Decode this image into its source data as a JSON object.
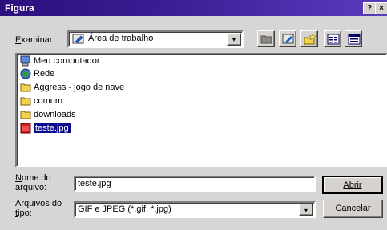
{
  "window": {
    "title": "Figura",
    "help_glyph": "?",
    "close_glyph": "×"
  },
  "lookin": {
    "label": "Examinar:",
    "value": "Área de trabalho",
    "dropdown_glyph": "▾"
  },
  "toolbar": {
    "icons": [
      "up-folder-icon",
      "desktop-icon",
      "new-folder-icon",
      "list-view-icon",
      "details-view-icon"
    ]
  },
  "files": [
    {
      "name": "Meu computador",
      "icon": "computer-icon"
    },
    {
      "name": "Rede",
      "icon": "network-icon"
    },
    {
      "name": "Aggress - jogo de nave",
      "icon": "folder-icon"
    },
    {
      "name": "comum",
      "icon": "folder-icon"
    },
    {
      "name": "downloads",
      "icon": "folder-icon"
    },
    {
      "name": "teste.jpg",
      "icon": "image-file-icon",
      "selected": true
    }
  ],
  "filename": {
    "label_line1": "Nome do",
    "label_line2": "arquivo:",
    "value": "teste.jpg"
  },
  "filetype": {
    "label_line1": "Arquivos do",
    "label_line2": "tipo:",
    "value": "GIF e JPEG (*.gif, *.jpg)",
    "dropdown_glyph": "▾"
  },
  "buttons": {
    "open": "Abrir",
    "cancel": "Cancelar"
  }
}
